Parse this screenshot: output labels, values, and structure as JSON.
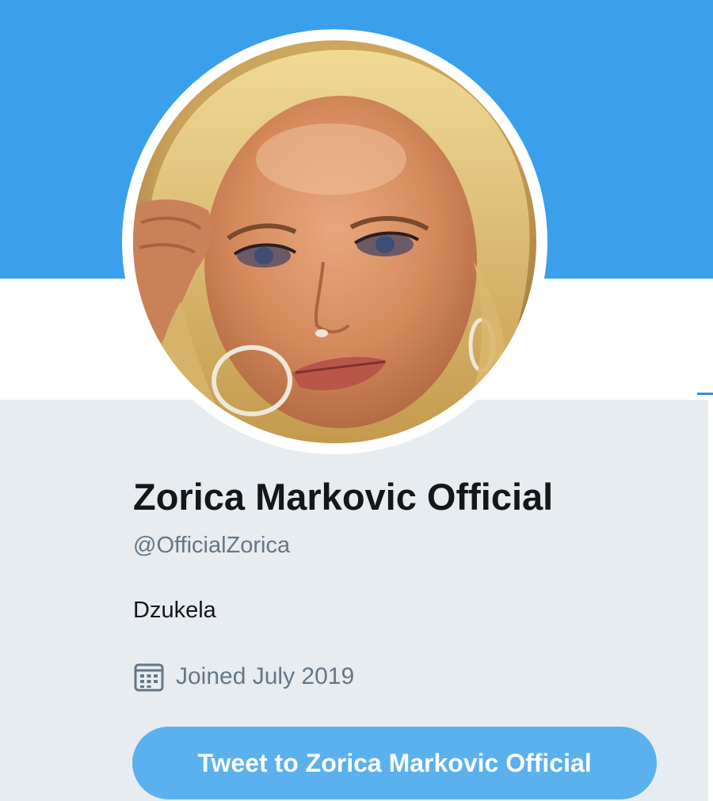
{
  "profile": {
    "display_name": "Zorica Markovic Official",
    "handle": "@OfficialZorica",
    "bio": "Dzukela",
    "joined": "Joined July 2019"
  },
  "actions": {
    "tweet_to_label": "Tweet to Zorica Markovic Official"
  },
  "icons": {
    "joined": "calendar-icon"
  },
  "colors": {
    "banner": "#3aa0ec",
    "card_background": "#e7ecf0",
    "tweet_button": "#5ab1ee",
    "name_text": "#14171a",
    "secondary_text": "#657786"
  }
}
